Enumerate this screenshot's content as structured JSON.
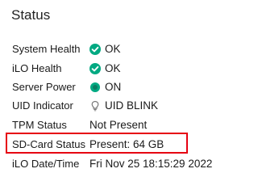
{
  "panel": {
    "title": "Status"
  },
  "rows": [
    {
      "label": "System Health",
      "value": "OK",
      "icon": "check-circle-icon",
      "icon_color": "#01a982"
    },
    {
      "label": "iLO Health",
      "value": "OK",
      "icon": "check-circle-icon",
      "icon_color": "#01a982"
    },
    {
      "label": "Server Power",
      "value": "ON",
      "icon": "power-dot-icon",
      "icon_color": "#01a982"
    },
    {
      "label": "UID Indicator",
      "value": "UID BLINK",
      "icon": "bulb-icon",
      "icon_color": "#7a7a7a"
    },
    {
      "label": "TPM Status",
      "value": "Not Present"
    },
    {
      "label": "SD-Card Status",
      "value": "Present: 64 GB",
      "highlighted": true,
      "highlight_color": "#e60012"
    },
    {
      "label": "iLO Date/Time",
      "value": "Fri Nov 25 18:15:29 2022"
    }
  ]
}
